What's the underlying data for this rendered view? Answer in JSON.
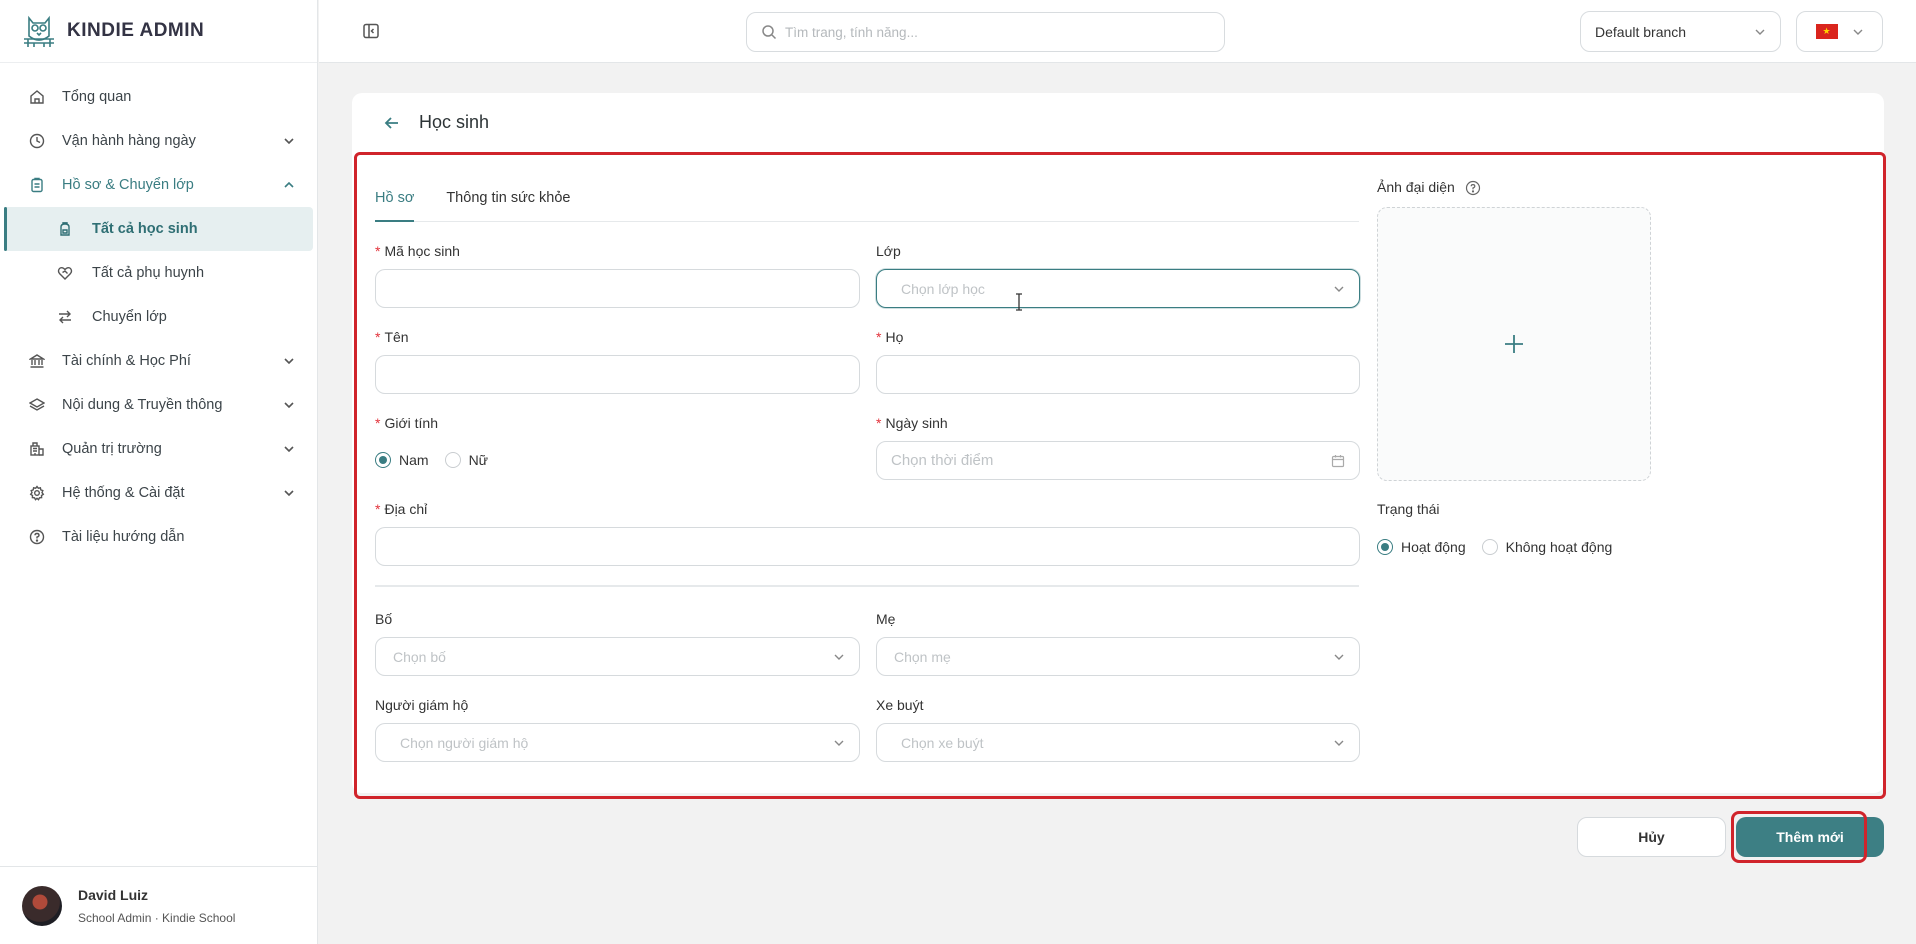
{
  "brand": {
    "name": "KINDIE ADMIN"
  },
  "sidebar": {
    "items": [
      {
        "label": "Tổng quan"
      },
      {
        "label": "Vận hành hàng ngày"
      },
      {
        "label": "Hồ sơ & Chuyển lớp"
      },
      {
        "label": "Tài chính & Học Phí"
      },
      {
        "label": "Nội dung & Truyền thông"
      },
      {
        "label": "Quản trị trường"
      },
      {
        "label": "Hệ thống & Cài đặt"
      },
      {
        "label": "Tài liệu hướng dẫn"
      }
    ],
    "subitems": [
      {
        "label": "Tất cả học sinh"
      },
      {
        "label": "Tất cả phụ huynh"
      },
      {
        "label": "Chuyển lớp"
      }
    ]
  },
  "user": {
    "name": "David Luiz",
    "role": "School Admin · Kindie School"
  },
  "topbar": {
    "search_placeholder": "Tìm trang, tính năng...",
    "branch": "Default branch"
  },
  "page": {
    "title": "Học sinh"
  },
  "tabs": [
    {
      "label": "Hồ sơ"
    },
    {
      "label": "Thông tin sức khỏe"
    }
  ],
  "form": {
    "student_code": {
      "label": "Mã học sinh",
      "value": ""
    },
    "class": {
      "label": "Lớp",
      "placeholder": "Chọn lớp học"
    },
    "first_name": {
      "label": "Tên",
      "value": ""
    },
    "last_name": {
      "label": "Họ",
      "value": ""
    },
    "gender": {
      "label": "Giới tính",
      "options": [
        "Nam",
        "Nữ"
      ],
      "selected": "Nam"
    },
    "birthday": {
      "label": "Ngày sinh",
      "placeholder": "Chọn thời điểm"
    },
    "address": {
      "label": "Địa chỉ",
      "value": ""
    },
    "father": {
      "label": "Bố",
      "placeholder": "Chọn bố"
    },
    "mother": {
      "label": "Mẹ",
      "placeholder": "Chọn mẹ"
    },
    "guardian": {
      "label": "Người giám hộ",
      "placeholder": "Chọn người giám hộ"
    },
    "bus": {
      "label": "Xe buýt",
      "placeholder": "Chọn xe buýt"
    },
    "avatar": {
      "label": "Ảnh đại diện"
    },
    "status": {
      "label": "Trạng thái",
      "options": [
        "Hoạt động",
        "Không hoạt động"
      ],
      "selected": "Hoạt động"
    }
  },
  "actions": {
    "cancel": "Hủy",
    "submit": "Thêm mới"
  },
  "colors": {
    "accent": "#3a7d82",
    "highlight": "#d0242b",
    "required": "#e2323b"
  }
}
